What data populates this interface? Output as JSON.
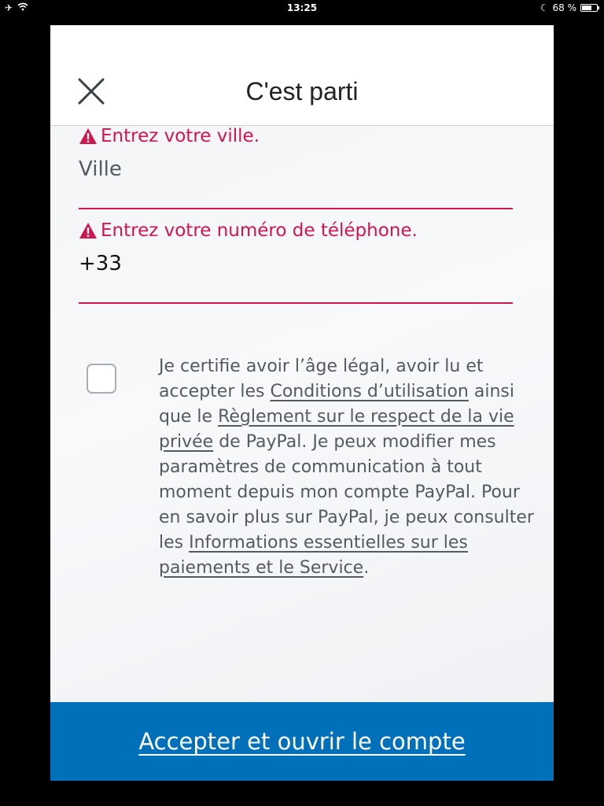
{
  "status_bar": {
    "time": "13:25",
    "battery_percent_label": "68 %",
    "battery_level": 0.68,
    "icons": [
      "airplane-icon",
      "wifi-icon",
      "moon-icon",
      "battery-icon"
    ]
  },
  "header": {
    "title": "C'est parti",
    "close_icon": "close-icon"
  },
  "form": {
    "city": {
      "error": "Entrez votre ville.",
      "placeholder": "Ville",
      "error_icon": "warning-icon"
    },
    "phone": {
      "error": "Entrez votre numéro de téléphone.",
      "value": "+33",
      "error_icon": "warning-icon"
    }
  },
  "consent": {
    "checked": false,
    "text_1": "Je certifie avoir l’âge légal, avoir lu et accepter les ",
    "link_terms": "Conditions d’utilisation",
    "text_2": " ainsi que le ",
    "link_privacy": "Règlement sur le respect de la vie privée",
    "text_3": " de PayPal. Je peux modifier mes paramètres de communication à tout moment depuis mon compte PayPal. Pour en savoir plus sur PayPal, je peux consulter les ",
    "link_info": "Informations essentielles sur les paiements et le Service",
    "text_4": "."
  },
  "cta": {
    "label": "Accepter et ouvrir le compte"
  },
  "colors": {
    "error": "#d0154f",
    "primary": "#0070ba",
    "text_muted": "#555a60"
  }
}
